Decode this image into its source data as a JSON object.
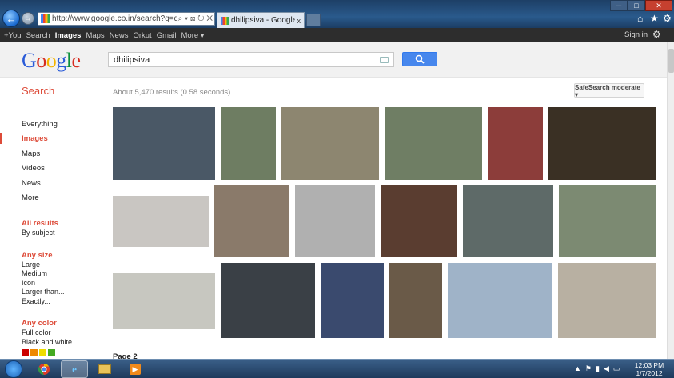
{
  "browser": {
    "url": "http://www.google.co.in/search?q=dhilipsiva&hl=",
    "tab_title": "dhilipsiva - Google Search",
    "tab_close": "x",
    "address_controls": "⌕ ▾ ⊠ ↻ ✕"
  },
  "google_bar": {
    "items": [
      "+You",
      "Search",
      "Images",
      "Maps",
      "News",
      "Orkut",
      "Gmail",
      "More ▾"
    ],
    "active": "Images",
    "sign_in": "Sign in"
  },
  "header": {
    "logo": [
      "G",
      "o",
      "o",
      "g",
      "l",
      "e"
    ],
    "query": "dhilipsiva"
  },
  "results": {
    "section_label": "Search",
    "stats": "About 5,470 results (0.58 seconds)",
    "safesearch": "SafeSearch moderate ▾"
  },
  "sidebar": {
    "types": [
      "Everything",
      "Images",
      "Maps",
      "Videos",
      "News",
      "More"
    ],
    "active_type": "Images",
    "result_filter": [
      "All results",
      "By subject"
    ],
    "size_header": "Any size",
    "sizes": [
      "Large",
      "Medium",
      "Icon",
      "Larger than...",
      "Exactly..."
    ],
    "color_header": "Any color",
    "colors": [
      "Full color",
      "Black and white"
    ],
    "swatch_colors": [
      "#cc0000",
      "#ee8800",
      "#eedd00",
      "#44aa22"
    ]
  },
  "images": [
    {
      "bg": "#4a5866"
    },
    {
      "bg": "#6e7d62"
    },
    {
      "bg": "#8d8670"
    },
    {
      "bg": "#6f7e64"
    },
    {
      "bg": "#8c3d3a"
    },
    {
      "bg": "#3a3024"
    },
    {
      "bg": "#c9c6c2"
    },
    {
      "bg": "#8a7a6a"
    },
    {
      "bg": "#b0b0b0"
    },
    {
      "bg": "#5a3d30"
    },
    {
      "bg": "#5e6a68"
    },
    {
      "bg": "#7c8a72"
    },
    {
      "bg": "#c7c7c0"
    },
    {
      "bg": "#3a4046"
    },
    {
      "bg": "#3a4a6e"
    },
    {
      "bg": "#6a5a48"
    },
    {
      "bg": "#9fb3c8"
    },
    {
      "bg": "#b8b0a2"
    }
  ],
  "pagination": {
    "label": "Page 2"
  },
  "taskbar": {
    "time": "12:03 PM",
    "date": "1/7/2012"
  }
}
